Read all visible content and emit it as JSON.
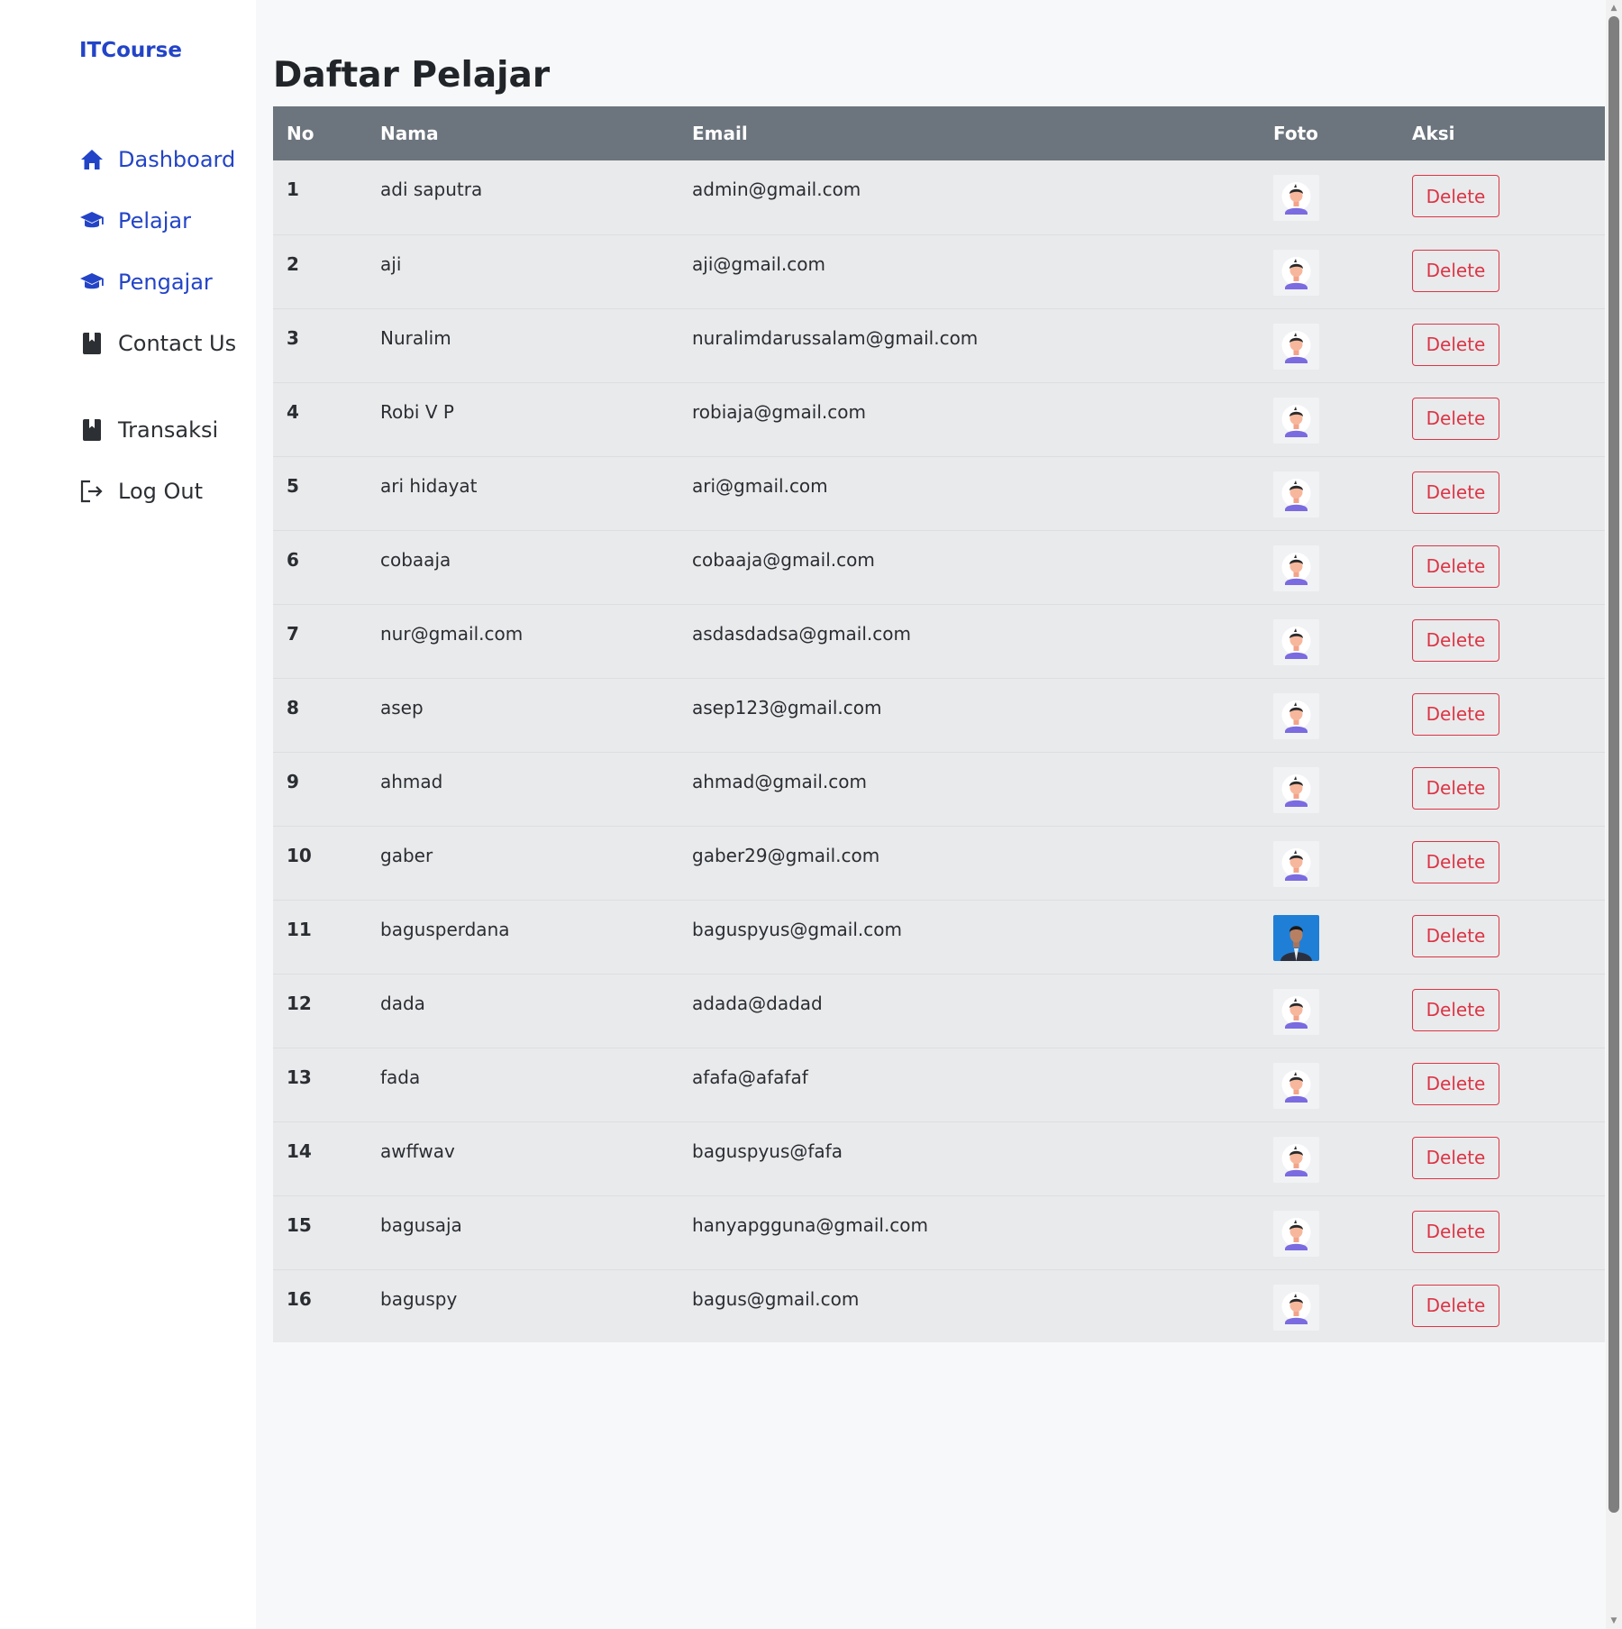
{
  "sidebar": {
    "brand": "ITCourse",
    "items": [
      {
        "label": "Dashboard",
        "icon": "home-icon"
      },
      {
        "label": "Pelajar",
        "icon": "graduation-cap-icon"
      },
      {
        "label": "Pengajar",
        "icon": "graduation-cap-icon"
      },
      {
        "label": "Contact Us",
        "icon": "book-icon"
      },
      {
        "label": "Transaksi",
        "icon": "book-icon"
      },
      {
        "label": "Log Out",
        "icon": "logout-icon"
      }
    ]
  },
  "main": {
    "title": "Daftar Pelajar",
    "table": {
      "headers": [
        "No",
        "Nama",
        "Email",
        "Foto",
        "Aksi"
      ],
      "delete_label": "Delete",
      "rows": [
        {
          "no": "1",
          "nama": "adi saputra",
          "email": "admin@gmail.com",
          "foto": "default-avatar"
        },
        {
          "no": "2",
          "nama": "aji",
          "email": "aji@gmail.com",
          "foto": "default-avatar"
        },
        {
          "no": "3",
          "nama": "Nuralim",
          "email": "nuralimdarussalam@gmail.com",
          "foto": "default-avatar"
        },
        {
          "no": "4",
          "nama": "Robi V P",
          "email": "robiaja@gmail.com",
          "foto": "default-avatar"
        },
        {
          "no": "5",
          "nama": "ari hidayat",
          "email": "ari@gmail.com",
          "foto": "default-avatar"
        },
        {
          "no": "6",
          "nama": "cobaaja",
          "email": "cobaaja@gmail.com",
          "foto": "default-avatar"
        },
        {
          "no": "7",
          "nama": "nur@gmail.com",
          "email": "asdasdadsa@gmail.com",
          "foto": "default-avatar"
        },
        {
          "no": "8",
          "nama": "asep",
          "email": "asep123@gmail.com",
          "foto": "default-avatar"
        },
        {
          "no": "9",
          "nama": "ahmad",
          "email": "ahmad@gmail.com",
          "foto": "default-avatar"
        },
        {
          "no": "10",
          "nama": "gaber",
          "email": "gaber29@gmail.com",
          "foto": "default-avatar"
        },
        {
          "no": "11",
          "nama": "bagusperdana",
          "email": "baguspyus@gmail.com",
          "foto": "user-photo"
        },
        {
          "no": "12",
          "nama": "dada",
          "email": "adada@dadad",
          "foto": "default-avatar"
        },
        {
          "no": "13",
          "nama": "fada",
          "email": "afafa@afafaf",
          "foto": "default-avatar"
        },
        {
          "no": "14",
          "nama": "awffwav",
          "email": "baguspyus@fafa",
          "foto": "default-avatar"
        },
        {
          "no": "15",
          "nama": "bagusaja",
          "email": "hanyapgguna@gmail.com",
          "foto": "default-avatar"
        },
        {
          "no": "16",
          "nama": "baguspy",
          "email": "bagus@gmail.com",
          "foto": "default-avatar"
        }
      ]
    }
  },
  "colors": {
    "brand": "#2344c7",
    "header_bg": "#6c757d",
    "danger": "#dc3545",
    "row_bg": "#e9eaec"
  }
}
